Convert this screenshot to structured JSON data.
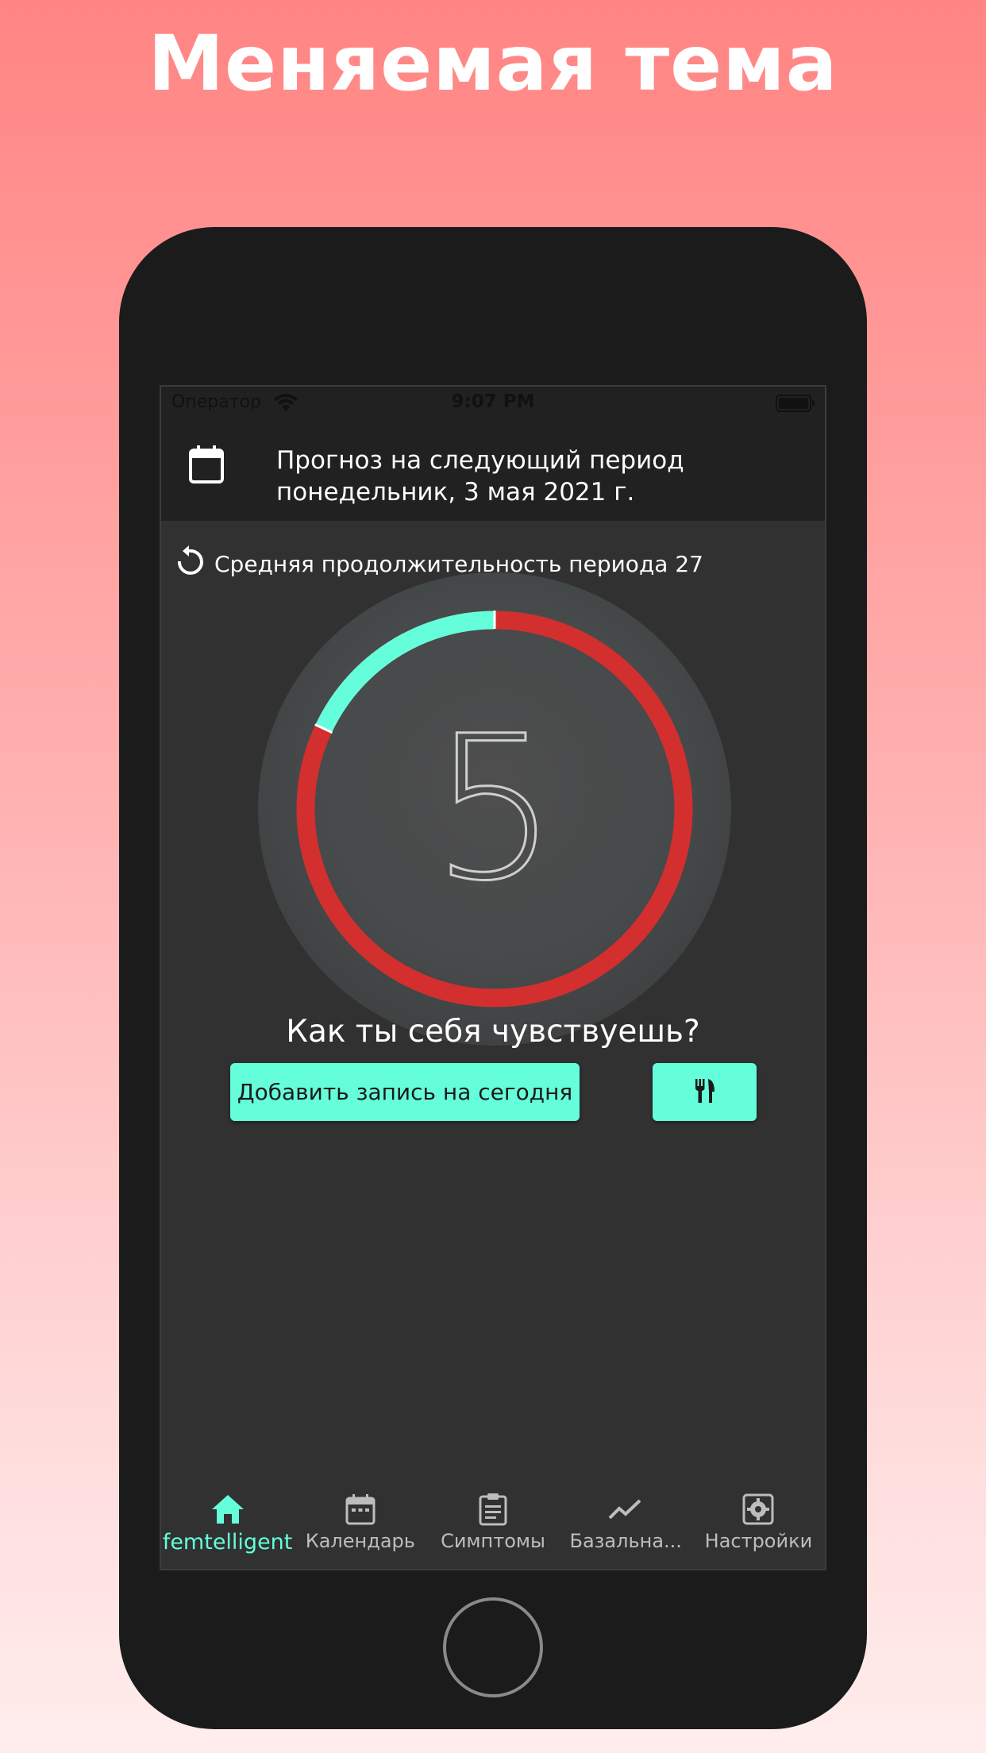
{
  "headline": "Меняемая тема",
  "status_bar": {
    "carrier": "Оператор",
    "time": "9:07 PM"
  },
  "header": {
    "line1": "Прогноз на следующий период",
    "line2": "понедельник, 3 мая 2021 г."
  },
  "average": {
    "text": "Средняя продолжительность периода 27"
  },
  "ring": {
    "number": "5",
    "period_fraction": 0.18,
    "colors": {
      "period": "#64ffda",
      "cycle": "#d32f2f",
      "disc": "#4a4a4a"
    }
  },
  "question": "Как ты себя чувствуешь?",
  "buttons": {
    "add_today": "Добавить запись на сегодня",
    "food_icon": "fork-knife-icon"
  },
  "tabs": [
    {
      "label": "femtelligent",
      "icon": "home-icon",
      "active": true
    },
    {
      "label": "Календарь",
      "icon": "calendar-icon",
      "active": false
    },
    {
      "label": "Симптомы",
      "icon": "clipboard-icon",
      "active": false
    },
    {
      "label": "Базальна...",
      "icon": "trend-chart-icon",
      "active": false
    },
    {
      "label": "Настройки",
      "icon": "settings-icon",
      "active": false
    }
  ],
  "accent_color": "#64ffda"
}
